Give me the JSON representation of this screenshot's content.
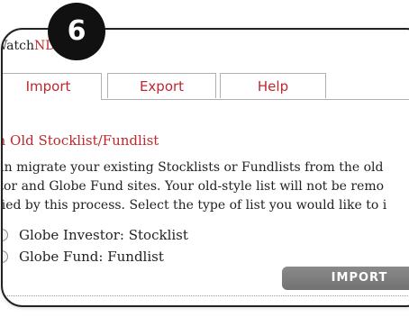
{
  "step_badge": "6",
  "panel": {
    "title_prefix": "Watch",
    "title_accent": "NDS"
  },
  "tabs": [
    {
      "label": "Import",
      "active": true
    },
    {
      "label": "Export",
      "active": false
    },
    {
      "label": "Help",
      "active": false
    }
  ],
  "section": {
    "heading": "om Old Stocklist/Fundlist",
    "description_lines": [
      "u can migrate your existing Stocklists or Fundlists from the old",
      "vestor and Globe Fund sites. Your old-style list will not be remo",
      "odified by this process. Select the type of list you would like to i"
    ]
  },
  "options": [
    {
      "label": "Globe Investor: Stocklist",
      "selected": false
    },
    {
      "label": "Globe Fund: Fundlist",
      "selected": false
    }
  ],
  "import_button_label": "IMPORT",
  "colors": {
    "accent_red": "#c0272d",
    "button_gray": "#7d7d7d",
    "badge_black": "#111111"
  }
}
